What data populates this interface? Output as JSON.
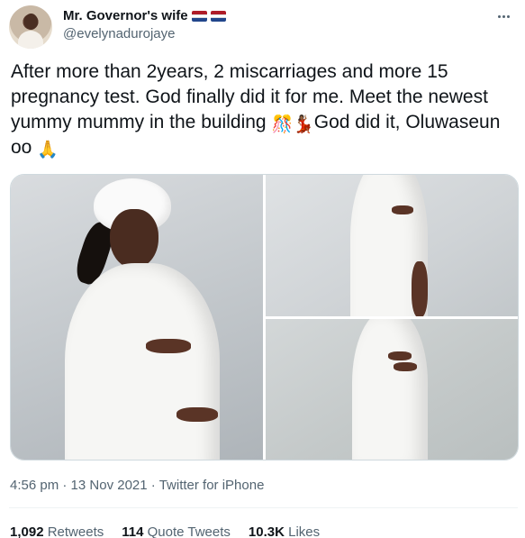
{
  "user": {
    "display_name": "Mr. Governor's wife",
    "handle": "@evelynadurojaye",
    "avatar_icon": "profile-photo",
    "badge_icon": "netherlands-flag-emoji",
    "flag_colors": [
      "#ae1c28",
      "#ffffff",
      "#21468b"
    ]
  },
  "more_icon": "ellipsis-icon",
  "tweet": {
    "text_before": "After more than 2years, 2 miscarriages and more 15 pregnancy test. God finally did it for me. Meet the newest yummy mummy in the building ",
    "emoji_1": "💃🏾",
    "emoji_1_alt": "dancing-emojis",
    "text_middle": "God did it, Oluwaseun oo ",
    "emoji_2": "🙏",
    "emoji_2_alt": "folded-hands-emoji"
  },
  "media": {
    "photos": [
      {
        "name": "photo-1",
        "description_icon": "maternity-photo"
      },
      {
        "name": "photo-2",
        "description_icon": "maternity-photo"
      },
      {
        "name": "photo-3",
        "description_icon": "maternity-photo"
      }
    ]
  },
  "meta": {
    "time": "4:56 pm",
    "separator": "·",
    "date": "13 Nov 2021",
    "source": "Twitter for iPhone"
  },
  "stats": {
    "retweets_count": "1,092",
    "retweets_label": "Retweets",
    "quotes_count": "114",
    "quotes_label": "Quote Tweets",
    "likes_count": "10.3K",
    "likes_label": "Likes"
  },
  "colors": {
    "text": "#0f1419",
    "secondary": "#536471",
    "border": "#cfd9de"
  }
}
